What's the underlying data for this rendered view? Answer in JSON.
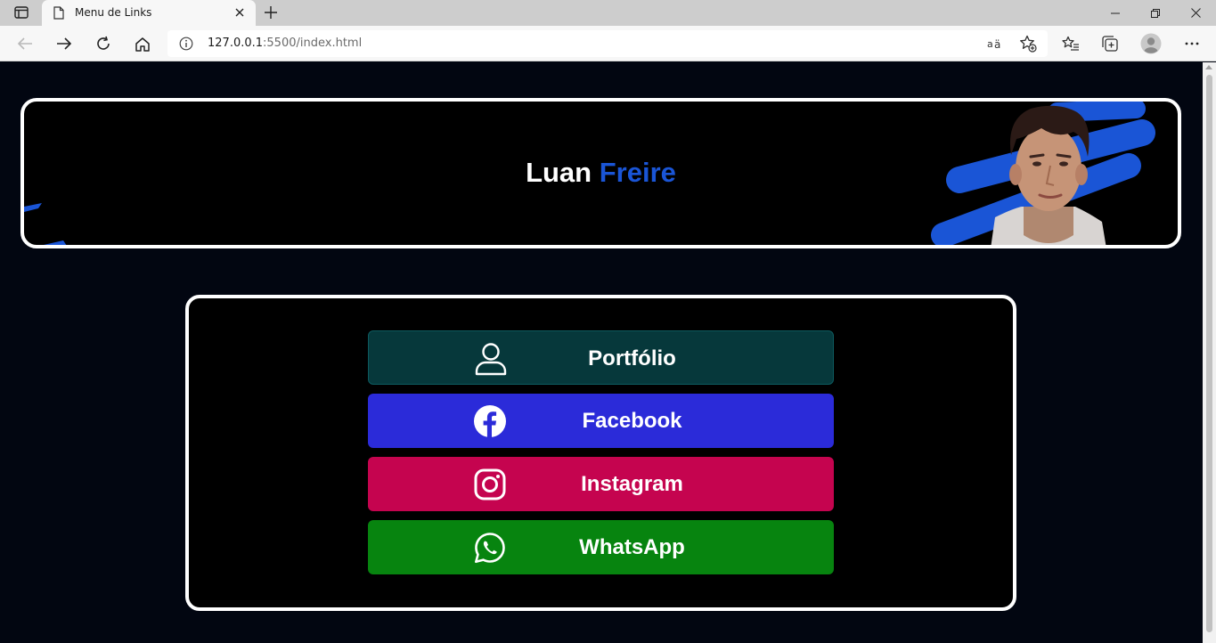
{
  "browser": {
    "tab_title": "Menu de Links",
    "url_host": "127.0.0.1",
    "url_rest": ":5500/index.html"
  },
  "banner": {
    "first_name": "Luan",
    "last_name": "Freire",
    "accent_color": "#1a55d6"
  },
  "links": [
    {
      "label": "Portfólio",
      "icon": "user-icon",
      "color": "#06383b"
    },
    {
      "label": "Facebook",
      "icon": "facebook-icon",
      "color": "#2b2bd9"
    },
    {
      "label": "Instagram",
      "icon": "instagram-icon",
      "color": "#c5044f"
    },
    {
      "label": "WhatsApp",
      "icon": "whatsapp-icon",
      "color": "#07840f"
    }
  ]
}
